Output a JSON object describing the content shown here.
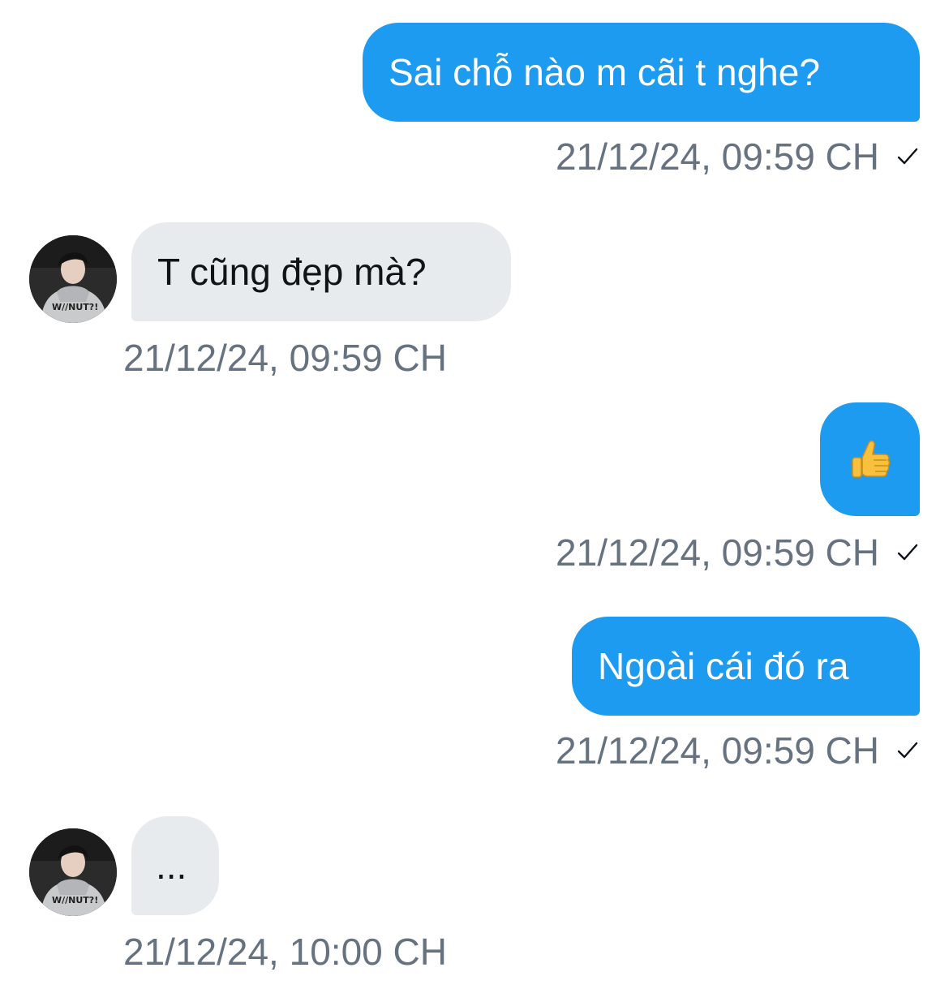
{
  "messages": [
    {
      "direction": "sent",
      "text": "Sai chỗ nào m cãi t nghe?",
      "timestamp": "21/12/24, 09:59 CH",
      "status_icon": "checkmark-icon"
    },
    {
      "direction": "received",
      "text": "T cũng đẹp mà?",
      "timestamp": "21/12/24, 09:59 CH",
      "avatar": "avatar"
    },
    {
      "direction": "sent",
      "text": "👍",
      "timestamp": "21/12/24, 09:59 CH",
      "status_icon": "checkmark-icon",
      "content_icon": "thumbs-up-icon"
    },
    {
      "direction": "sent",
      "text": "Ngoài cái đó ra",
      "timestamp": "21/12/24, 09:59 CH",
      "status_icon": "checkmark-icon"
    },
    {
      "direction": "received",
      "text": "...",
      "timestamp": "21/12/24, 10:00 CH",
      "avatar": "avatar"
    }
  ],
  "colors": {
    "sent_bubble": "#1d9bf0",
    "received_bubble": "#e7ebee",
    "timestamp_text": "#66727f"
  }
}
